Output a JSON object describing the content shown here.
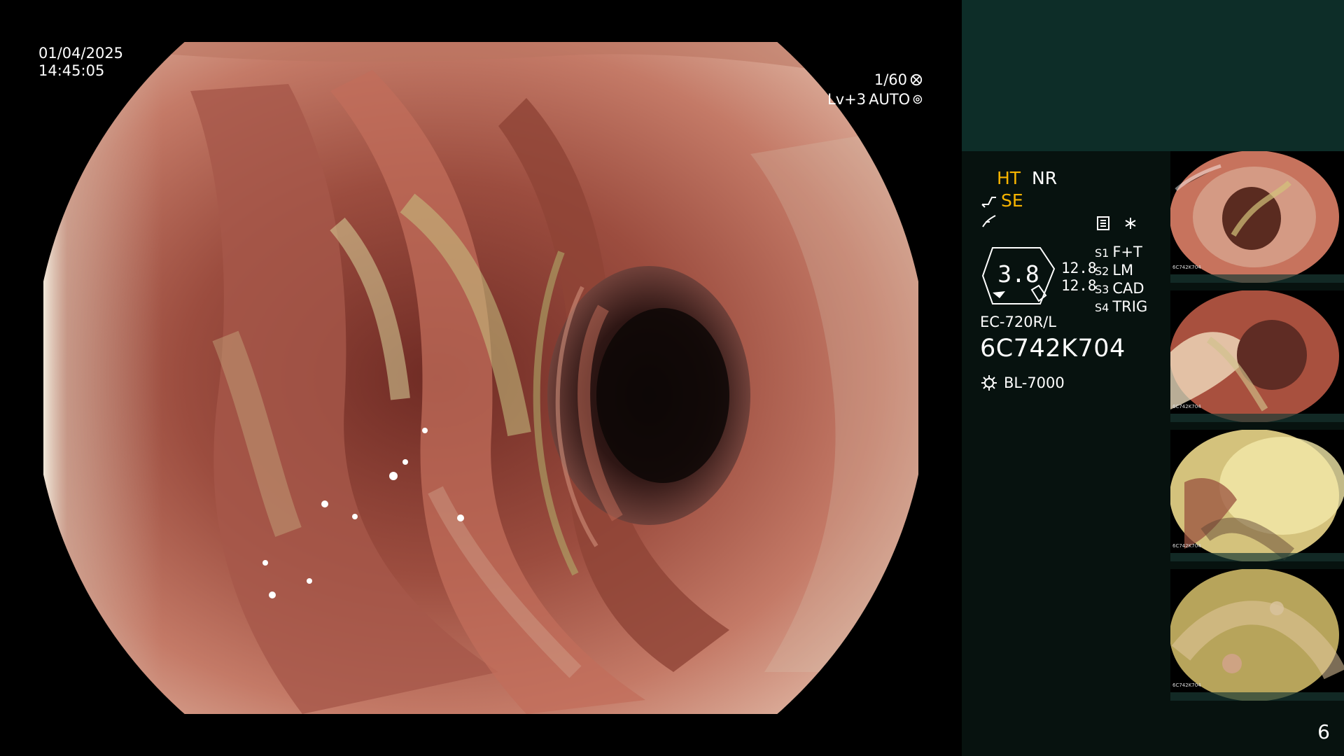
{
  "main": {
    "date": "01/04/2025",
    "time": "14:45:05",
    "shutter": "1/60",
    "level": "Lv+3",
    "iris": "AUTO"
  },
  "sidebar": {
    "mode_ht": "HT",
    "mode_nr": "NR",
    "mode_se": "SE",
    "gauge_value": "3.8",
    "left_values": [
      "12.8",
      "12.8"
    ],
    "switches": [
      {
        "key": "S1",
        "value": "F+T"
      },
      {
        "key": "S2",
        "value": "LM"
      },
      {
        "key": "S3",
        "value": "CAD"
      },
      {
        "key": "S4",
        "value": "TRIG"
      }
    ],
    "scope_model": "EC-720R/L",
    "scope_serial": "6C742K704",
    "light_source": "BL-7000",
    "thumbnail_labels": [
      "6C742K704",
      "6C742K704",
      "6C742K704",
      "6C742K704"
    ],
    "page_number": "6"
  }
}
